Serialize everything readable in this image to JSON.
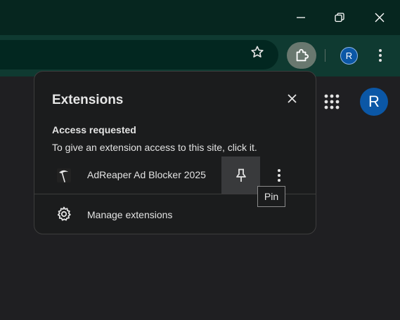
{
  "window": {
    "minimize_icon": "minimize-icon",
    "restore_icon": "restore-icon",
    "close_icon": "close-icon"
  },
  "toolbar": {
    "bookmark_icon": "star-icon",
    "extensions_icon": "puzzle-icon",
    "profile_initial": "R",
    "menu_icon": "kebab-icon"
  },
  "page": {
    "profile_initial": "R"
  },
  "popup": {
    "title": "Extensions",
    "section_heading": "Access requested",
    "section_description": "To give an extension access to this site, click it.",
    "extensions": [
      {
        "name": "AdReaper Ad Blocker 2025",
        "icon": "scythe-icon"
      }
    ],
    "manage_label": "Manage extensions"
  },
  "tooltip": {
    "text": "Pin"
  },
  "colors": {
    "titlebar": "#06261f",
    "toolbar": "#0f3a31",
    "omnibox": "#022720",
    "extensions_button_active": "#69786f",
    "popup_bg": "#1b1c1d",
    "pin_hover": "#393a3c",
    "profile_blue": "#0b57a6"
  }
}
